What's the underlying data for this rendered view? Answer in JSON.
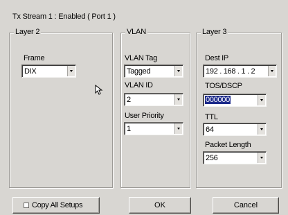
{
  "window": {
    "title": "Tx Stream 1 : Enabled    ( Port 1 )"
  },
  "groups": {
    "layer2": {
      "legend": "Layer 2",
      "frame_label": "Frame",
      "frame_value": "DIX"
    },
    "vlan": {
      "legend": "VLAN",
      "tag_label": "VLAN Tag",
      "tag_value": "Tagged",
      "id_label": "VLAN ID",
      "id_value": "2",
      "priority_label": "User Priority",
      "priority_value": "1"
    },
    "layer3": {
      "legend": "Layer 3",
      "dest_ip_label": "Dest IP",
      "dest_ip_value": "192 . 168 .  1  .  2",
      "tos_label": "TOS/DSCP",
      "tos_value": "000000",
      "ttl_label": "TTL",
      "ttl_value": "64",
      "length_label": "Packet Length",
      "length_value": "256"
    }
  },
  "footer": {
    "copy_all_label": "Copy All Setups",
    "copy_all_checked": false,
    "ok_label": "OK",
    "cancel_label": "Cancel"
  },
  "colors": {
    "background": "#d8d6d2",
    "selection": "#1c2a8a"
  }
}
